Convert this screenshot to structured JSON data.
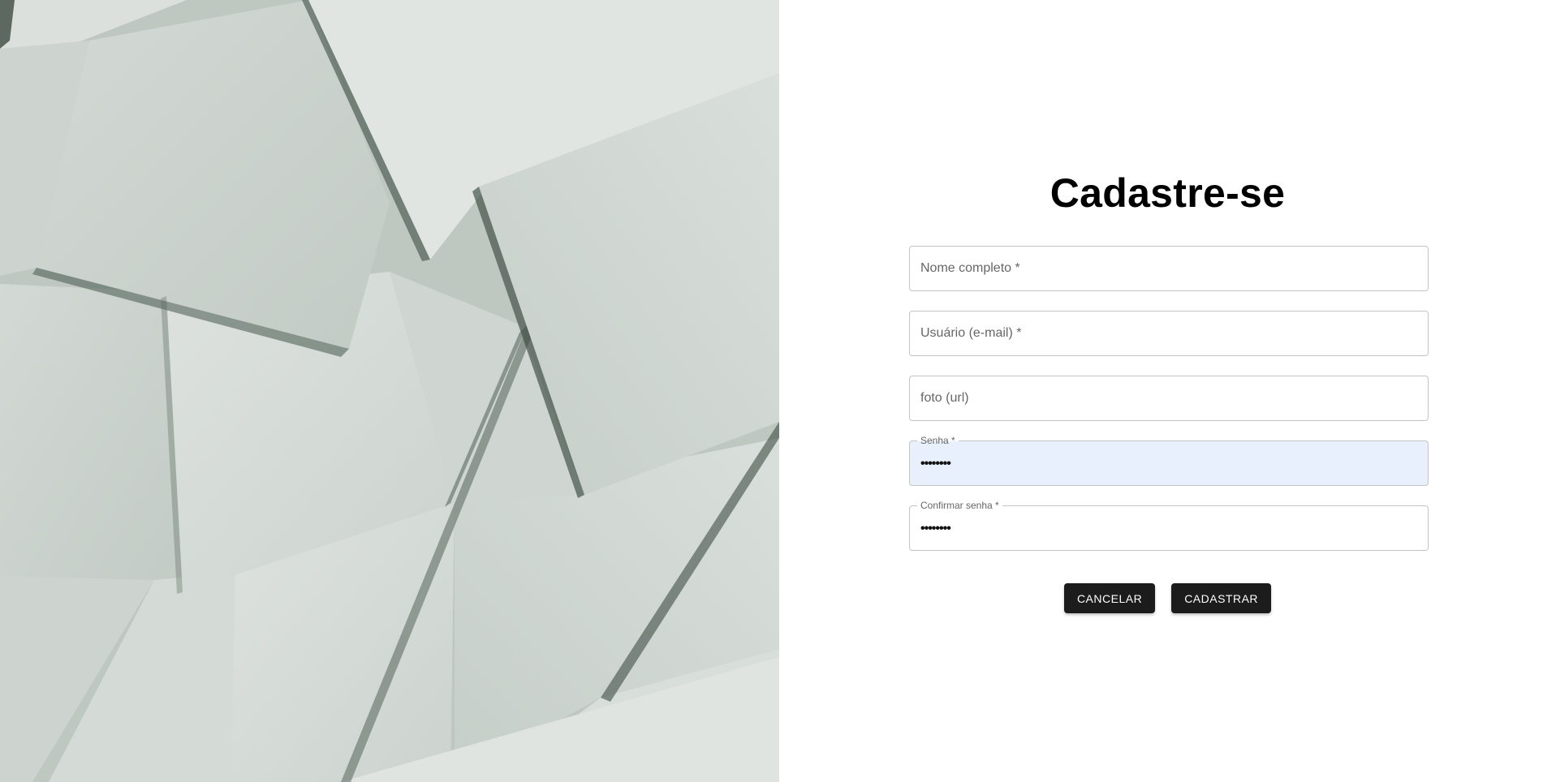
{
  "hero": {
    "image": "overlapping-paper-sheets-photo"
  },
  "form": {
    "title": "Cadastre-se",
    "fields": {
      "full_name": {
        "placeholder": "Nome completo *",
        "value": ""
      },
      "username": {
        "placeholder": "Usuário (e-mail) *",
        "value": ""
      },
      "photo": {
        "placeholder": "foto (url)",
        "value": ""
      },
      "password": {
        "label": "Senha *",
        "value": "••••••••"
      },
      "confirm_password": {
        "label": "Confirmar senha *",
        "value": "••••••••"
      }
    },
    "buttons": {
      "cancel": "CANCELAR",
      "submit": "CADASTRAR"
    }
  },
  "colors": {
    "button_bg": "#1c1c1c",
    "autofill_bg": "#e8f0fe",
    "field_border": "#c4c4c4"
  }
}
